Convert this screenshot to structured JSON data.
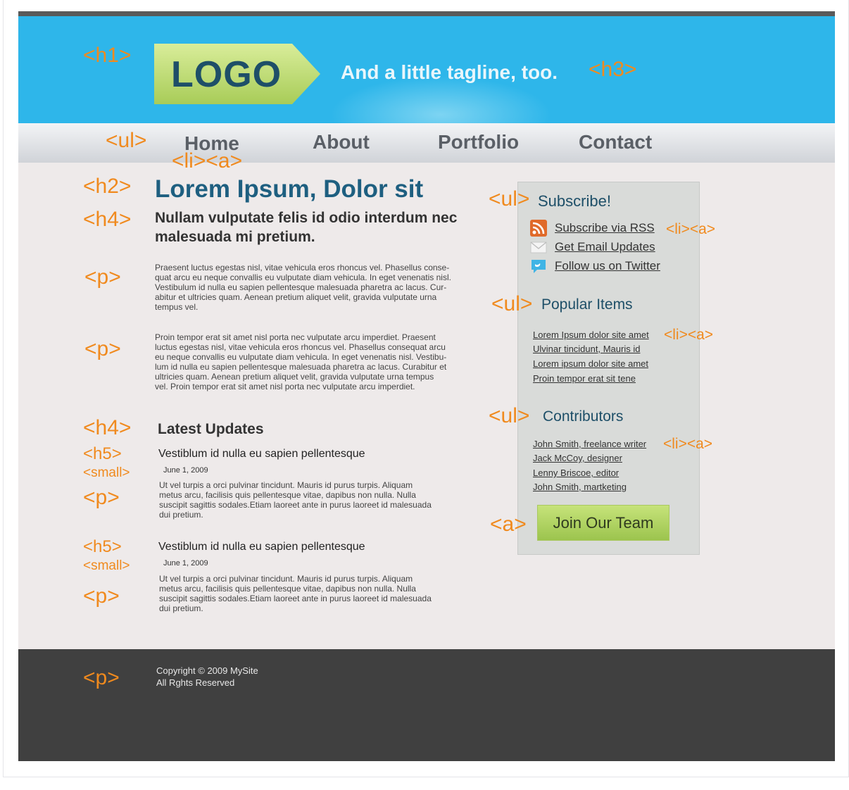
{
  "header": {
    "logo_text": "LOGO",
    "tagline": "And a little tagline, too."
  },
  "nav": {
    "items": [
      "Home",
      "About",
      "Portfolio",
      "Contact"
    ]
  },
  "main": {
    "title": "Lorem Ipsum, Dolor sit",
    "subtitle": "Nullam vulputate felis id odio interdum nec malesuada mi pretium.",
    "para1_lines": [
      "Praesent luctus egestas nisl, vitae vehicula eros rhoncus vel. Phasellus conse-",
      "quat arcu eu neque convallis eu vulputate diam vehicula. In eget venenatis nisl.",
      "Vestibulum id nulla eu sapien pellentesque malesuada pharetra ac lacus. Cur-",
      "abitur et ultricies quam. Aenean pretium aliquet velit, gravida vulputate urna",
      "tempus vel."
    ],
    "para2_lines": [
      "Proin tempor erat sit amet nisl porta nec vulputate arcu imperdiet. Praesent",
      "luctus egestas nisl, vitae vehicula eros rhoncus vel. Phasellus consequat arcu",
      "eu neque convallis eu vulputate diam vehicula. In eget venenatis nisl. Vestibu-",
      "lum id nulla eu sapien pellentesque malesuada pharetra ac lacus. Curabitur et",
      "ultricies quam. Aenean pretium aliquet velit, gravida vulputate urna tempus",
      "vel. Proin tempor erat sit amet nisl porta nec vulputate arcu imperdiet."
    ],
    "latest_updates": "Latest Updates",
    "posts": [
      {
        "title": "Vestiblum id nulla eu sapien pellentesque",
        "date": "June 1, 2009",
        "lines": [
          "Ut vel turpis a orci pulvinar tincidunt. Mauris id purus turpis. Aliquam",
          "metus arcu, facilisis quis pellentesque vitae, dapibus non nulla. Nulla",
          "suscipit sagittis sodales.Etiam laoreet ante in purus laoreet id malesuada",
          "dui pretium."
        ]
      },
      {
        "title": "Vestiblum id nulla eu sapien pellentesque",
        "date": "June 1, 2009",
        "lines": [
          "Ut vel turpis a orci pulvinar tincidunt. Mauris id purus turpis. Aliquam",
          "metus arcu, facilisis quis pellentesque vitae, dapibus non nulla. Nulla",
          "suscipit sagittis sodales.Etiam laoreet ante in purus laoreet id malesuada",
          "dui pretium."
        ]
      }
    ]
  },
  "sidebar": {
    "subscribe_heading": "Subscribe!",
    "subscribe_links": [
      {
        "label": "Subscribe via RSS",
        "icon": "rss-icon"
      },
      {
        "label": "Get Email Updates",
        "icon": "email-icon"
      },
      {
        "label": "Follow us on Twitter",
        "icon": "twitter-icon"
      }
    ],
    "popular_heading": "Popular Items",
    "popular_links": [
      "Lorem Ipsum dolor site amet",
      "Ulvinar tincidunt, Mauris id",
      "Lorem ipsum dolor site amet",
      "Proin tempor erat sit tene"
    ],
    "contributors_heading": "Contributors",
    "contributors": [
      "John Smith, freelance writer",
      "Jack McCoy, designer",
      "Lenny Briscoe, editor",
      "John Smith, martketing"
    ],
    "join_button": "Join Our Team"
  },
  "footer": {
    "copyright": "Copyright © 2009 MySite",
    "rights": "All Rghts Reserved"
  },
  "annotations": {
    "h1": "<h1>",
    "ul": "<ul>",
    "li_a": "<li><a>",
    "h2": "<h2>",
    "h3": "<h3>",
    "h4": "<h4>",
    "h5": "<h5>",
    "p": "<p>",
    "small": "<small>",
    "a": "<a>"
  },
  "colors": {
    "header_blue": "#2eb6ea",
    "annotation_orange": "#f08a1e",
    "title_blue": "#1e5f80",
    "footer_dark": "#404040",
    "button_green": "#b2d466"
  }
}
